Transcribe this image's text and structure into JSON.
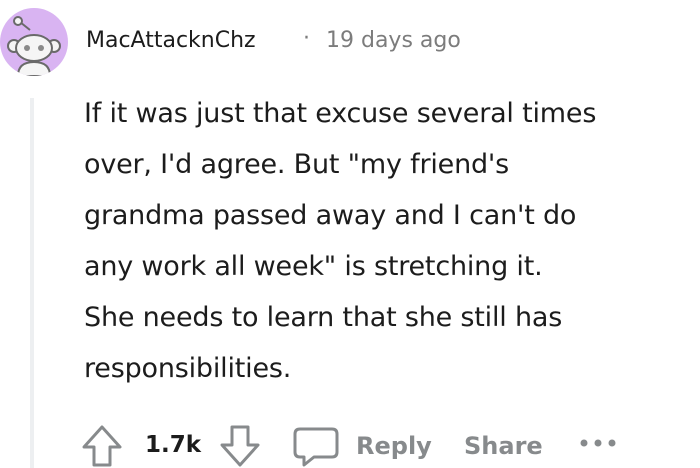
{
  "comment": {
    "author": "MacAttacknChz",
    "separator": "·",
    "timestamp": "19 days ago",
    "body_lines": [
      "If it was just that excuse several times",
      "over, I'd agree. But \"my friend's",
      "grandma passed away and I can't do",
      "any work all week\" is stretching it.",
      "She needs to learn that she still has",
      "responsibilities."
    ]
  },
  "actions": {
    "upvote_icon": "upvote-arrow-icon",
    "score": "1.7k",
    "downvote_icon": "downvote-arrow-icon",
    "reply_icon": "speech-bubble-icon",
    "reply_label": "Reply",
    "share_label": "Share",
    "more_icon": "more-options-icon"
  },
  "colors": {
    "avatar_background": "#d9b4f2",
    "text_primary": "#1c1c1c",
    "text_secondary": "#878a8c",
    "thread_line": "#edeff1"
  }
}
